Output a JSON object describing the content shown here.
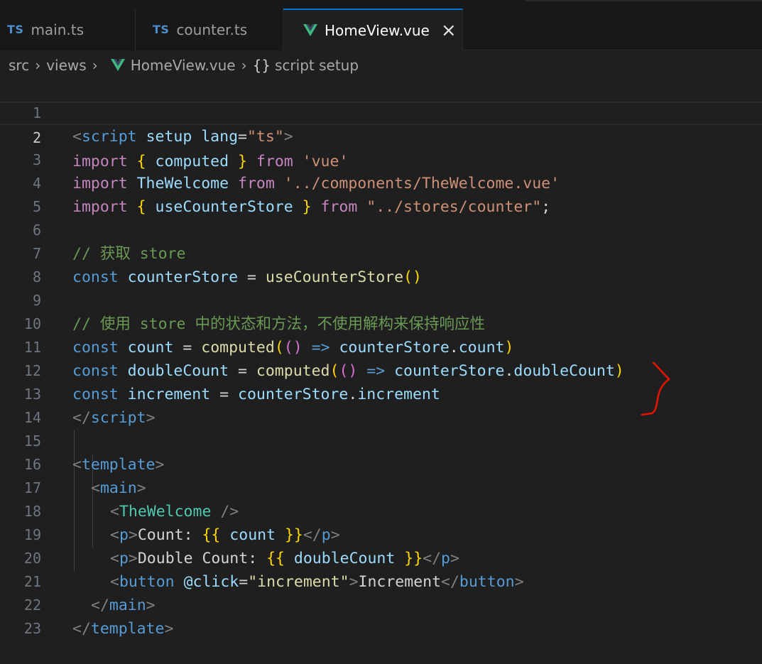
{
  "tabs": [
    {
      "icon": "TS",
      "label": "main.ts"
    },
    {
      "icon": "TS",
      "label": "counter.ts"
    },
    {
      "icon": "vue-icon",
      "label": "HomeView.vue",
      "active": true
    }
  ],
  "breadcrumb": {
    "src": "src",
    "views": "views",
    "file": "HomeView.vue",
    "braces": "{}",
    "symbol": "script setup"
  },
  "lines": [
    {
      "n": "1"
    },
    {
      "n": "2"
    },
    {
      "n": "3"
    },
    {
      "n": "4"
    },
    {
      "n": "5"
    },
    {
      "n": "6"
    },
    {
      "n": "7"
    },
    {
      "n": "8"
    },
    {
      "n": "9"
    },
    {
      "n": "10"
    },
    {
      "n": "11"
    },
    {
      "n": "12"
    },
    {
      "n": "13"
    },
    {
      "n": "14"
    },
    {
      "n": "15"
    },
    {
      "n": "16"
    },
    {
      "n": "17"
    },
    {
      "n": "18"
    },
    {
      "n": "19"
    },
    {
      "n": "20"
    },
    {
      "n": "21"
    },
    {
      "n": "22"
    },
    {
      "n": "23"
    }
  ],
  "code": {
    "l1": [
      "<",
      "script",
      " setup",
      " lang",
      "=",
      "\"ts\"",
      ">"
    ],
    "l2": [
      "import",
      " ",
      "{",
      " computed ",
      "}",
      " from",
      " ",
      "'vue'"
    ],
    "l3": [
      "import",
      " TheWelcome",
      " from",
      " ",
      "'../components/TheWelcome.vue'"
    ],
    "l4": [
      "import",
      " ",
      "{",
      " useCounterStore ",
      "}",
      " from",
      " ",
      "\"../stores/counter\"",
      ";"
    ],
    "l6": "// 获取 store",
    "l7": [
      "const",
      " counterStore",
      " = ",
      "useCounterStore",
      "()"
    ],
    "l9": "// 使用 store 中的状态和方法，不使用解构来保持响应性",
    "l10": [
      "const",
      " count",
      " = ",
      "computed",
      "(",
      "()",
      " =>",
      " counterStore",
      ".",
      "count",
      ")"
    ],
    "l11": [
      "const",
      " doubleCount",
      " = ",
      "computed",
      "(",
      "()",
      " =>",
      " counterStore",
      ".",
      "doubleCount",
      ")"
    ],
    "l12": [
      "const",
      " increment",
      " = ",
      "counterStore",
      ".",
      "increment"
    ],
    "l13": [
      "</",
      "script",
      ">"
    ],
    "l15": [
      "<",
      "template",
      ">"
    ],
    "l16": [
      "<",
      "main",
      ">"
    ],
    "l17": [
      "<",
      "TheWelcome",
      " />"
    ],
    "l18": [
      "<",
      "p",
      ">",
      "Count: ",
      "{{",
      " count ",
      "}}",
      "</",
      "p",
      ">"
    ],
    "l19": [
      "<",
      "p",
      ">",
      "Double Count: ",
      "{{",
      " doubleCount ",
      "}}",
      "</",
      "p",
      ">"
    ],
    "l20": [
      "<",
      "button",
      " @click",
      "=",
      "\"increment\"",
      ">",
      "Increment",
      "</",
      "button",
      ">"
    ],
    "l21": [
      "</",
      "main",
      ">"
    ],
    "l22": [
      "</",
      "template",
      ">"
    ]
  },
  "colors": {
    "background": "#1f1f1f",
    "keyword": "#c586c0",
    "storage": "#569cd6",
    "variable": "#9cdcfe",
    "function": "#dcdcaa",
    "string": "#ce9178",
    "comment": "#6a9955",
    "component": "#4ec9b0",
    "annotation": "#e51400"
  }
}
